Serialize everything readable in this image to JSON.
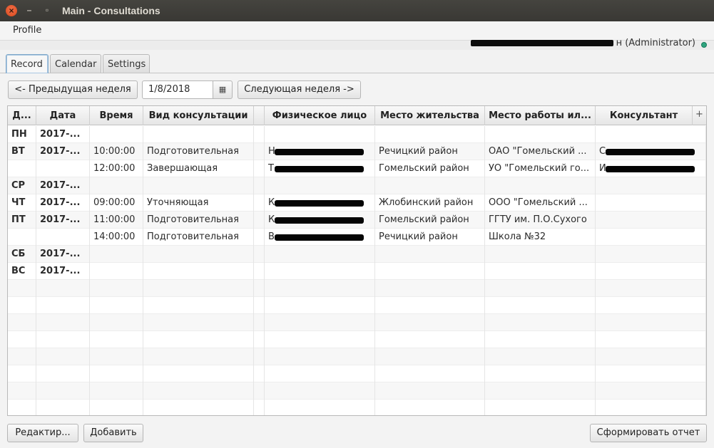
{
  "window": {
    "title": "Main - Consultations",
    "close_glyph": "×",
    "min_glyph": "–",
    "max_glyph": "▫"
  },
  "menu": {
    "profile": "Profile"
  },
  "user": {
    "role": "н (Administrator)",
    "status_color": "#2ea57f"
  },
  "tabs": [
    {
      "label": "Record"
    },
    {
      "label": "Calendar"
    },
    {
      "label": "Settings"
    }
  ],
  "nav": {
    "prev_label": "<- Предыдущая неделя",
    "date_value": "1/8/2018",
    "date_picker_icon": "calendar-icon",
    "next_label": "Следующая неделя ->"
  },
  "table": {
    "columns": [
      "Д...",
      "Дата",
      "Время",
      "Вид консультации",
      "",
      "Физическое лицо",
      "Место жительства",
      "Место работы ил...",
      "Консультант"
    ],
    "add_column_glyph": "+",
    "rows": [
      {
        "day": "ПН",
        "date": "2017-...",
        "time": "",
        "type": "",
        "person": "",
        "residence": "",
        "work": "",
        "consultant": ""
      },
      {
        "day": "ВТ",
        "date": "2017-...",
        "time": "10:00:00",
        "type": "Подготовительная",
        "person": "Н                  ...",
        "residence": "Речицкий район",
        "work": "ОАО \"Гомельский ...",
        "consultant": "С                 ..."
      },
      {
        "day": "",
        "date": "",
        "time": "12:00:00",
        "type": "Завершающая",
        "person": "Т                  ...",
        "residence": "Гомельский район",
        "work": "УО \"Гомельский го...",
        "consultant": "И                 ..."
      },
      {
        "day": "СР",
        "date": "2017-...",
        "time": "",
        "type": "",
        "person": "",
        "residence": "",
        "work": "",
        "consultant": ""
      },
      {
        "day": "ЧТ",
        "date": "2017-...",
        "time": "09:00:00",
        "type": "Уточняющая",
        "person": "К                  ...",
        "residence": "Жлобинский район",
        "work": "ООО \"Гомельский ...",
        "consultant": ""
      },
      {
        "day": "ПТ",
        "date": "2017-...",
        "time": "11:00:00",
        "type": "Подготовительная",
        "person": "К                  ...",
        "residence": "Гомельский район",
        "work": "ГГТУ им. П.О.Сухого",
        "consultant": ""
      },
      {
        "day": "",
        "date": "",
        "time": "14:00:00",
        "type": "Подготовительная",
        "person": "В                 ,...",
        "residence": "Речицкий район",
        "work": "Школа №32",
        "consultant": ""
      },
      {
        "day": "СБ",
        "date": "2017-...",
        "time": "",
        "type": "",
        "person": "",
        "residence": "",
        "work": "",
        "consultant": ""
      },
      {
        "day": "ВС",
        "date": "2017-...",
        "time": "",
        "type": "",
        "person": "",
        "residence": "",
        "work": "",
        "consultant": ""
      }
    ]
  },
  "footer": {
    "edit_label": "Редактир...",
    "add_label": "Добавить",
    "report_label": "Сформировать отчет"
  }
}
